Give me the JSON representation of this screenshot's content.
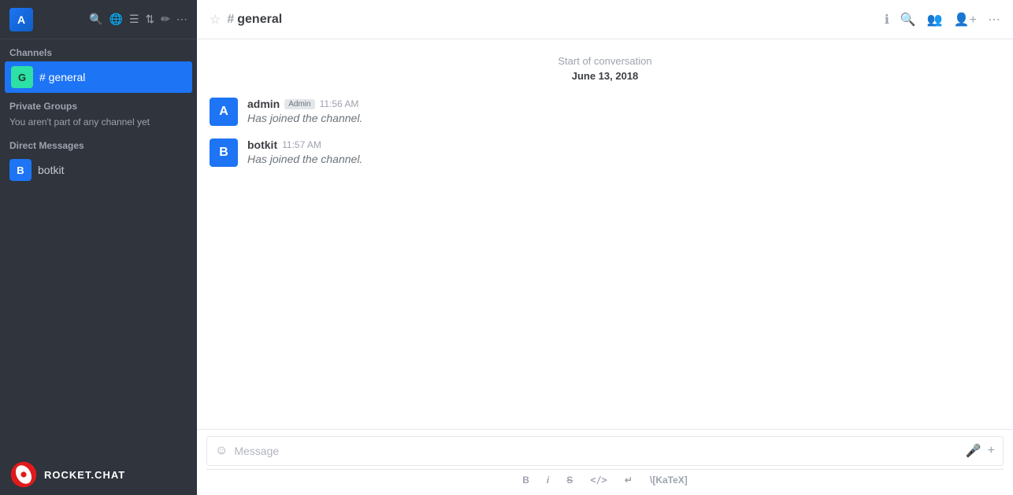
{
  "sidebar": {
    "header": {
      "avatar_letter": "A"
    },
    "channels_label": "Channels",
    "channels": [
      {
        "letter": "G",
        "name": "# general",
        "active": true
      }
    ],
    "private_groups_label": "Private Groups",
    "private_groups_empty": "You aren't part of any channel yet",
    "direct_messages_label": "Direct Messages",
    "direct_messages": [
      {
        "letter": "B",
        "name": "botkit"
      }
    ]
  },
  "footer": {
    "logo_text": "ROCKET.CHAT"
  },
  "header": {
    "channel_name": "general",
    "star_icon": "☆",
    "hash": "#"
  },
  "messages": {
    "start_text": "Start of conversation",
    "date": "June 13, 2018",
    "items": [
      {
        "avatar_letter": "A",
        "username": "admin",
        "badge": "Admin",
        "time": "11:56 AM",
        "text": "Has joined the channel."
      },
      {
        "avatar_letter": "B",
        "username": "botkit",
        "badge": "",
        "time": "11:57 AM",
        "text": "Has joined the channel."
      }
    ]
  },
  "input": {
    "placeholder": "Message"
  },
  "toolbar": {
    "bold": "B",
    "italic": "i",
    "strike": "S",
    "code": "</>",
    "quote": "↵",
    "katex": "\\[KaTeX]"
  }
}
